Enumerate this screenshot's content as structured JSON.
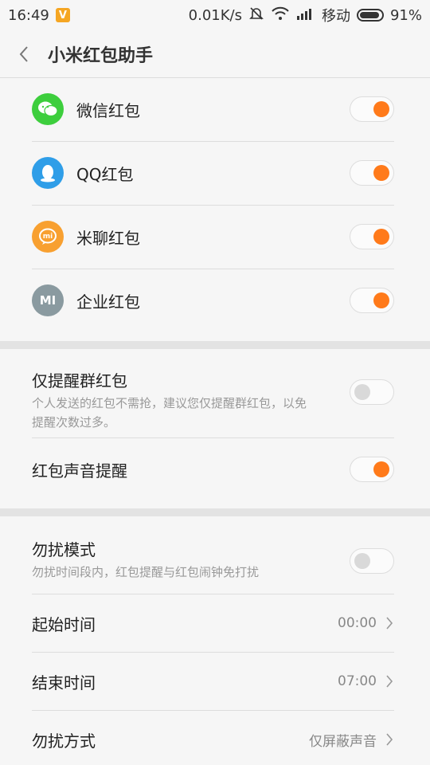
{
  "status": {
    "time": "16:49",
    "v_badge": "V",
    "speed": "0.01K/s",
    "carrier": "移动",
    "battery": "91%",
    "battery_level": 0.91
  },
  "header": {
    "title": "小米红包助手"
  },
  "sources": [
    {
      "label": "微信红包",
      "icon": "wechat-icon",
      "color": "#3dce3d",
      "on": true
    },
    {
      "label": "QQ红包",
      "icon": "qq-icon",
      "color": "#2f9ee8",
      "on": true
    },
    {
      "label": "米聊红包",
      "icon": "miliao-icon",
      "color": "#f8a030",
      "icon_text": "mi",
      "on": true
    },
    {
      "label": "企业红包",
      "icon": "mi-enterprise-icon",
      "color": "#8a9aa0",
      "icon_text": "MI",
      "on": true
    }
  ],
  "reminders": {
    "group_only": {
      "label": "仅提醒群红包",
      "desc": "个人发送的红包不需抢，建议您仅提醒群红包，以免提醒次数过多。",
      "on": false
    },
    "sound": {
      "label": "红包声音提醒",
      "on": true
    }
  },
  "dnd": {
    "mode": {
      "label": "勿扰模式",
      "desc": "勿扰时间段内，红包提醒与红包闹钟免打扰",
      "on": false
    },
    "start": {
      "label": "起始时间",
      "value": "00:00"
    },
    "end": {
      "label": "结束时间",
      "value": "07:00"
    },
    "method": {
      "label": "勿扰方式",
      "value": "仅屏蔽声音"
    }
  },
  "colors": {
    "accent": "#ff7a1a"
  }
}
